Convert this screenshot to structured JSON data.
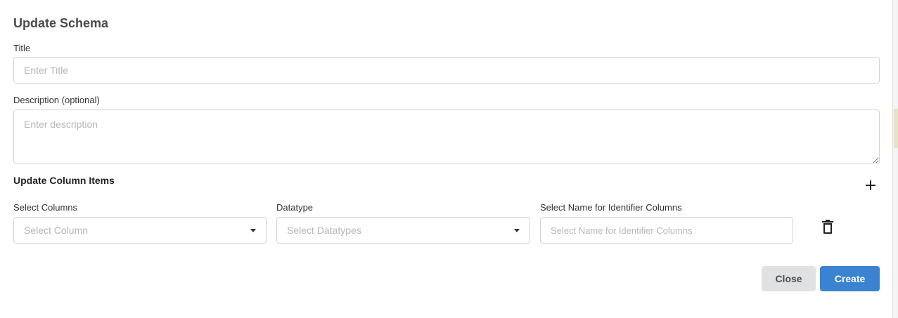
{
  "modal": {
    "title": "Update Schema",
    "title_field": {
      "label": "Title",
      "placeholder": "Enter Title",
      "value": ""
    },
    "description_field": {
      "label": "Description (optional)",
      "placeholder": "Enter description",
      "value": ""
    },
    "columns_section": {
      "title": "Update Column Items",
      "add_icon": "plus-icon",
      "row": {
        "columns": {
          "label": "Select Columns",
          "placeholder": "Select Column"
        },
        "datatype": {
          "label": "Datatype",
          "placeholder": "Select Datatypes"
        },
        "identifier": {
          "label": "Select Name for Identifier Columns",
          "placeholder": "Select Name for Identifier Columns",
          "value": ""
        },
        "delete_icon": "trash-icon"
      }
    },
    "buttons": {
      "close": "Close",
      "create": "Create"
    }
  },
  "colors": {
    "primary": "#3b83d0",
    "secondary": "#e0e1e2",
    "border": "#d4d4d5",
    "placeholder": "#b7b7b7"
  }
}
